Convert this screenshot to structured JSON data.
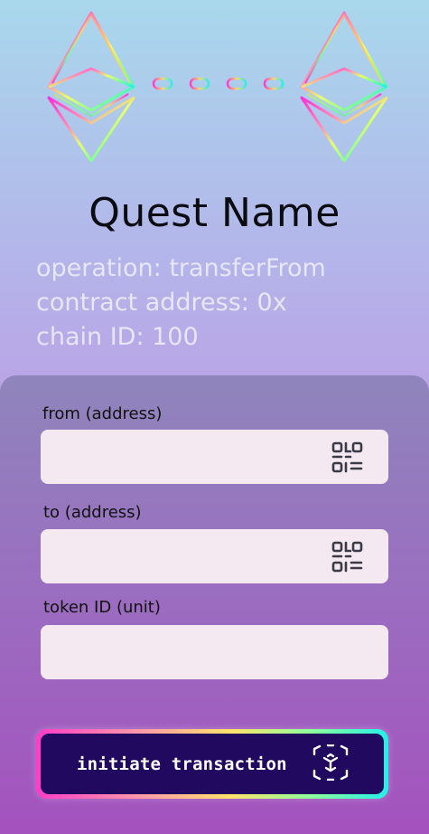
{
  "quest": {
    "title": "Quest Name",
    "operation_line": "operation: transferFrom",
    "contract_line": "contract address: 0x",
    "chain_line": "chain ID: 100"
  },
  "form": {
    "from_label": "from (address)",
    "to_label": "to (address)",
    "token_label": "token ID (unit)",
    "from_value": "",
    "to_value": "",
    "token_value": ""
  },
  "action": {
    "button_label": "initiate transaction"
  },
  "icons": {
    "left_logo": "ethereum-icon",
    "right_logo": "ethereum-icon",
    "link_chain": "chain-link-icon",
    "qr": "qr-code-icon",
    "cube": "cube-scan-icon"
  },
  "colors": {
    "button_bg": "#21095f",
    "field_bg": "#f4e9f1"
  }
}
